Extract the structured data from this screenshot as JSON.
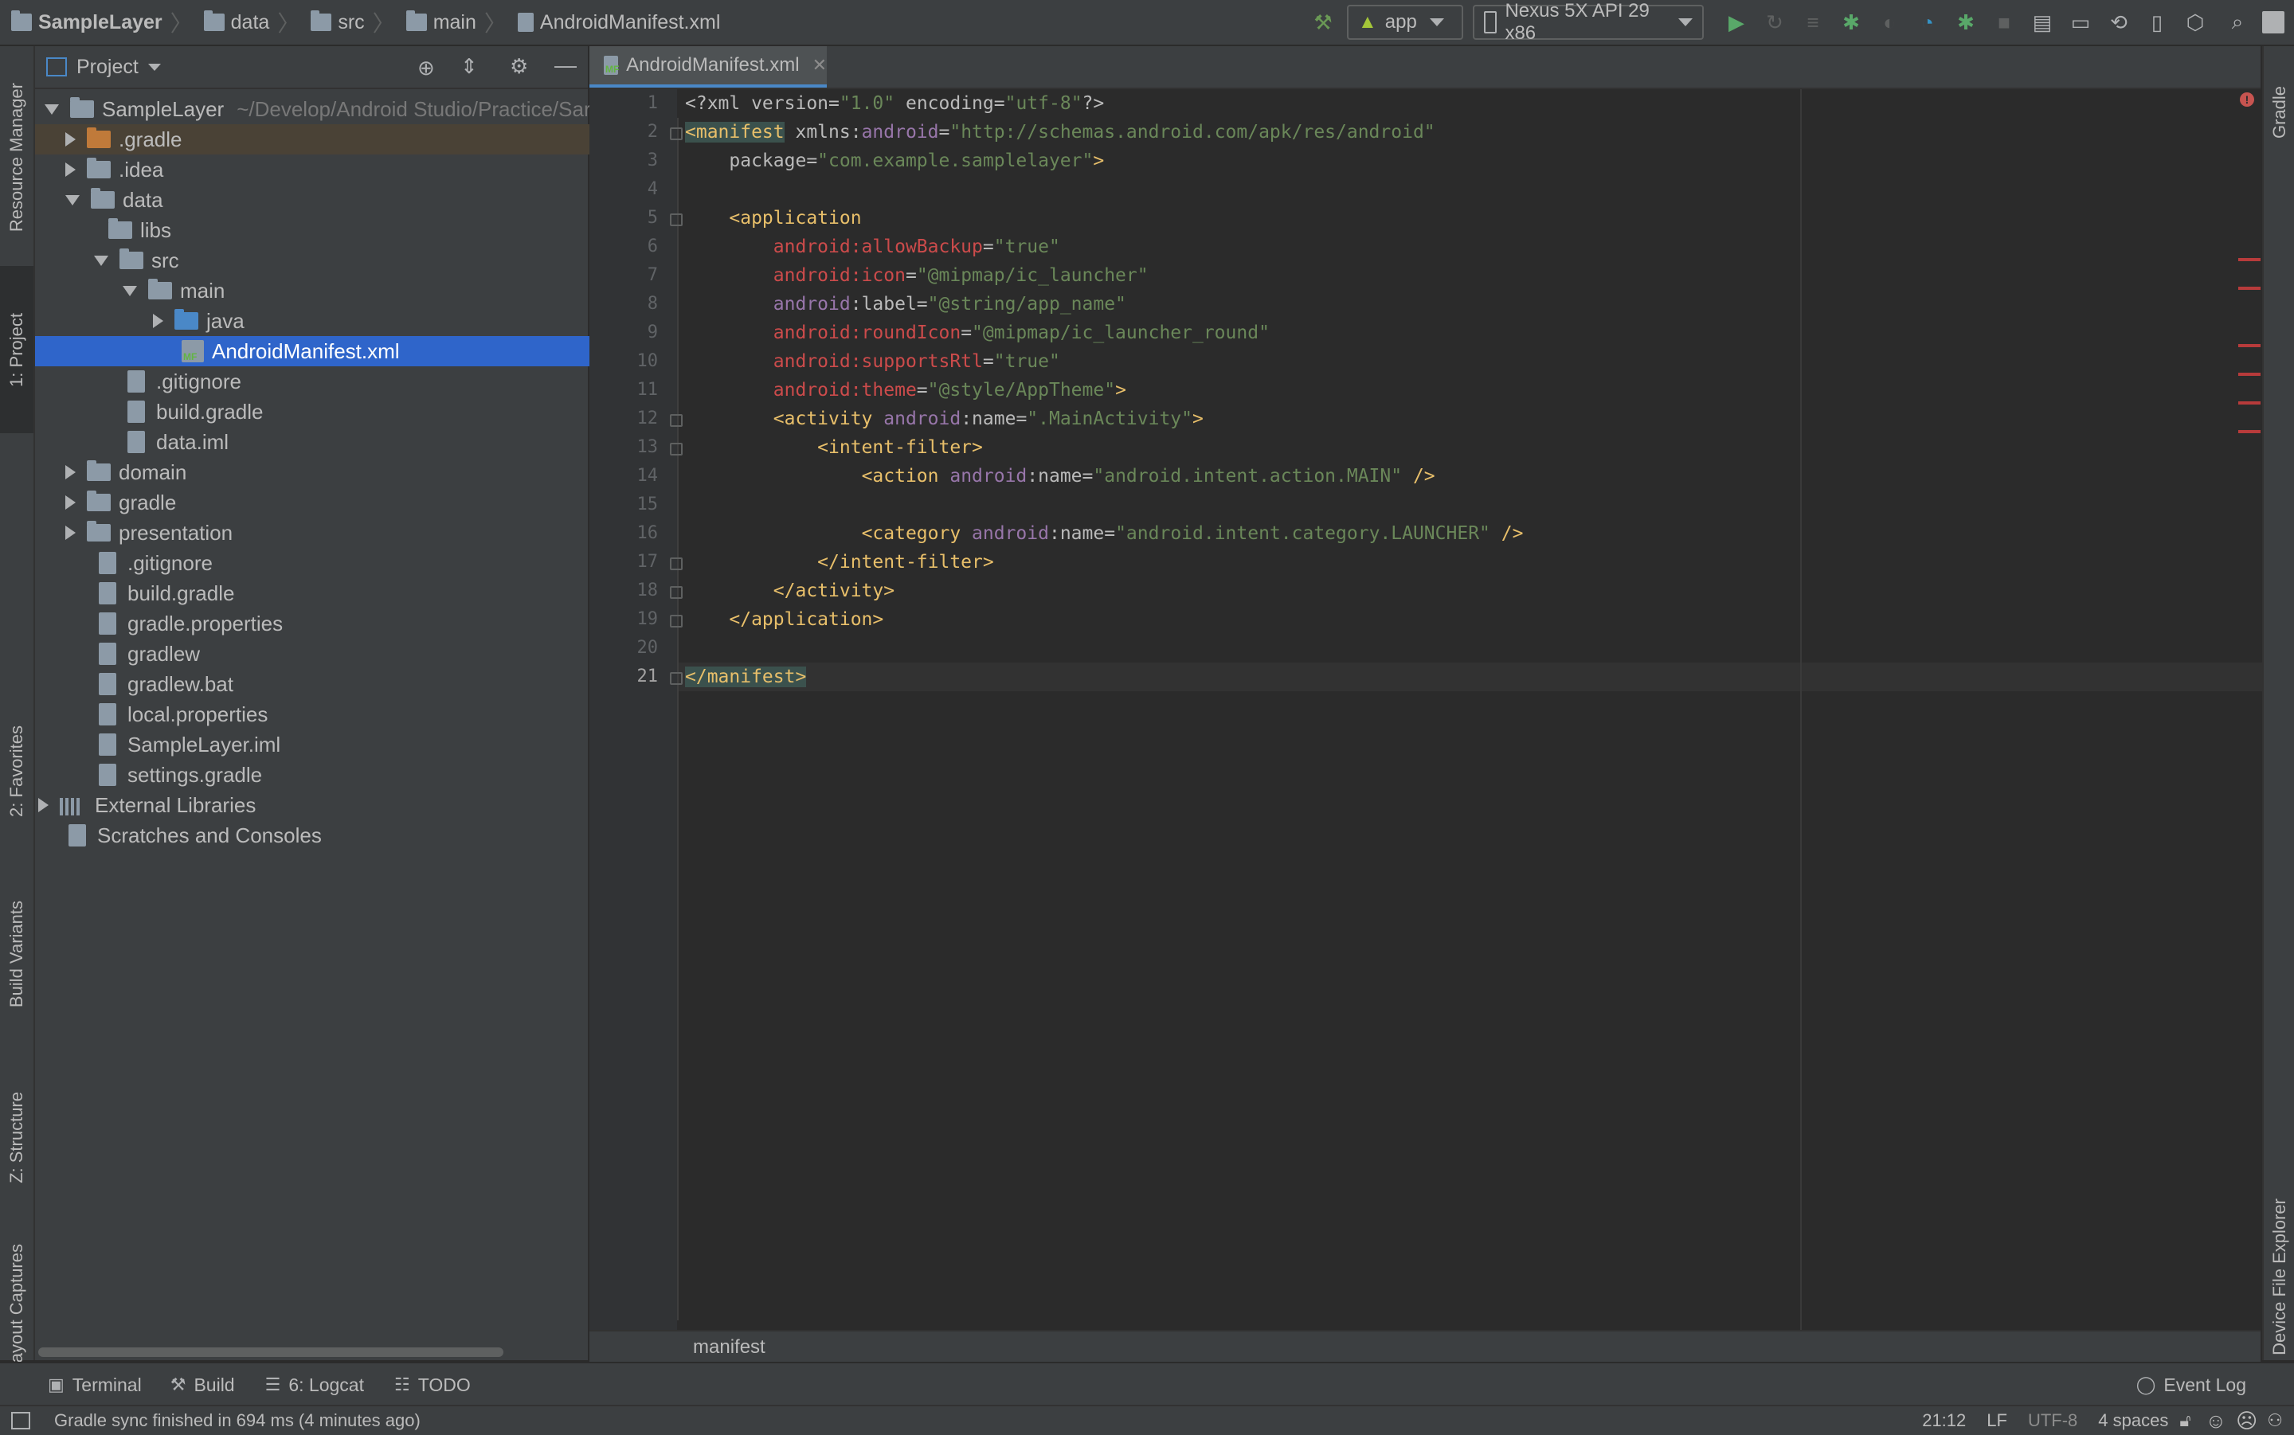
{
  "breadcrumbs": [
    "SampleLayer",
    "data",
    "src",
    "main",
    "AndroidManifest.xml"
  ],
  "run_config": "app",
  "device": "Nexus 5X API 29 x86",
  "left_tabs": [
    "Resource Manager",
    "1: Project",
    "2: Favorites",
    "Build Variants",
    "Z: Structure",
    "Layout Captures"
  ],
  "right_tabs": [
    "Gradle",
    "Device File Explorer"
  ],
  "project_panel": {
    "title": "Project",
    "root_path": "~/Develop/Android Studio/Practice/Sar",
    "tree": [
      "SampleLayer",
      ".gradle",
      ".idea",
      "data",
      "libs",
      "src",
      "main",
      "java",
      "AndroidManifest.xml",
      ".gitignore",
      "build.gradle",
      "data.iml",
      "domain",
      "gradle",
      "presentation",
      ".gitignore",
      "build.gradle",
      "gradle.properties",
      "gradlew",
      "gradlew.bat",
      "local.properties",
      "SampleLayer.iml",
      "settings.gradle",
      "External Libraries",
      "Scratches and Consoles"
    ]
  },
  "editor": {
    "tab": "AndroidManifest.xml",
    "line_numbers": [
      "1",
      "2",
      "3",
      "4",
      "5",
      "6",
      "7",
      "8",
      "9",
      "10",
      "11",
      "12",
      "13",
      "14",
      "15",
      "16",
      "17",
      "18",
      "19",
      "20",
      "21"
    ],
    "breadcrumb": "manifest",
    "code": {
      "l1": {
        "a": "<?xml version=",
        "b": "\"1.0\"",
        "c": " encoding=",
        "d": "\"utf-8\"",
        "e": "?>"
      },
      "l2": {
        "a": "<manifest",
        "b": " xmlns:",
        "c": "android",
        "d": "=",
        "e": "\"http://schemas.android.com/apk/res/android\""
      },
      "l3": {
        "a": "package=",
        "b": "\"com.example.samplelayer\"",
        "c": ">"
      },
      "l5": {
        "a": "<application"
      },
      "l6": {
        "a": "android:allowBackup",
        "b": "=",
        "c": "\"true\""
      },
      "l7": {
        "a": "android:icon",
        "b": "=",
        "c": "\"@mipmap/ic_launcher\""
      },
      "l8": {
        "a": "android",
        "b": ":label=",
        "c": "\"@string/app_name\""
      },
      "l9": {
        "a": "android:roundIcon",
        "b": "=",
        "c": "\"@mipmap/ic_launcher_round\""
      },
      "l10": {
        "a": "android:supportsRtl",
        "b": "=",
        "c": "\"true\""
      },
      "l11": {
        "a": "android:theme",
        "b": "=",
        "c": "\"@style/AppTheme\"",
        "d": ">"
      },
      "l12": {
        "a": "<activity ",
        "b": "android",
        "c": ":name=",
        "d": "\".MainActivity\"",
        "e": ">"
      },
      "l13": {
        "a": "<intent-filter>"
      },
      "l14": {
        "a": "<action ",
        "b": "android",
        "c": ":name=",
        "d": "\"android.intent.action.MAIN\"",
        "e": " />"
      },
      "l16": {
        "a": "<category ",
        "b": "android",
        "c": ":name=",
        "d": "\"android.intent.category.LAUNCHER\"",
        "e": " />"
      },
      "l17": {
        "a": "</intent-filter>"
      },
      "l18": {
        "a": "</activity>"
      },
      "l19": {
        "a": "</application>"
      },
      "l21": {
        "a": "</manifest>"
      }
    }
  },
  "tool_windows": [
    "Terminal",
    "Build",
    "6: Logcat",
    "TODO"
  ],
  "event_log": "Event Log",
  "status": {
    "message": "Gradle sync finished in 694 ms (4 minutes ago)",
    "position": "21:12",
    "line_sep": "LF",
    "encoding": "UTF-8",
    "indent": "4 spaces"
  }
}
